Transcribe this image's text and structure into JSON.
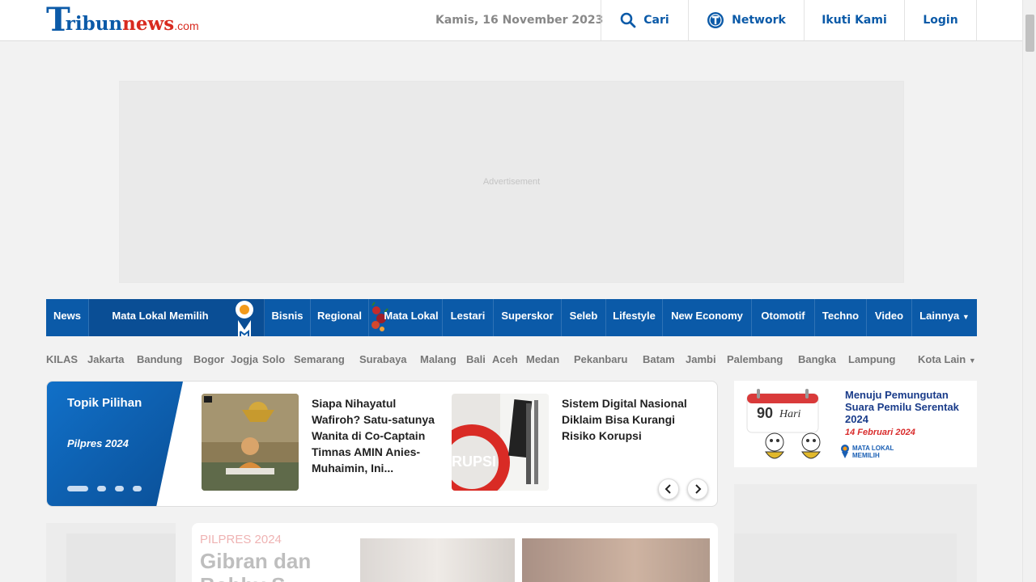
{
  "header": {
    "logo_t": "T",
    "logo_ribun": "ribun",
    "logo_news": "news",
    "logo_com": ".com",
    "date": "Kamis, 16 November 2023",
    "cari": "Cari",
    "network": "Network",
    "ikuti": "Ikuti Kami",
    "login": "Login"
  },
  "ad": {
    "label": "Advertisement"
  },
  "mainnav": {
    "items": [
      "News",
      "Mata Lokal Memilih",
      "Bisnis",
      "Regional",
      "Mata Lokal",
      "Lestari",
      "Superskor",
      "Seleb",
      "Lifestyle",
      "New Economy",
      "Otomotif",
      "Techno",
      "Video",
      "Lainnya"
    ]
  },
  "kilas": {
    "label": "KILAS",
    "cities": [
      "Jakarta",
      "Bandung",
      "Bogor",
      "Jogja",
      "Solo",
      "Semarang",
      "Surabaya",
      "Malang",
      "Bali",
      "Aceh",
      "Medan",
      "Pekanbaru",
      "Batam",
      "Jambi",
      "Palembang",
      "Bangka",
      "Lampung"
    ],
    "more": "Kota Lain"
  },
  "topik": {
    "title": "Topik Pilihan",
    "subtitle": "Pilpres 2024",
    "stories": [
      {
        "title": "Siapa Nihayatul Wafiroh? Satu-satunya Wanita di Co-Captain Timnas AMIN Anies-Muhaimin, Ini..."
      },
      {
        "title": "Sistem Digital Nasional Diklaim Bisa Kurangi Risiko Korupsi"
      }
    ],
    "thumb2_text": "RUPSI"
  },
  "banner": {
    "days": "90",
    "hari": "Hari",
    "line1": "Menuju Pemungutan Suara Pemilu Serentak 2024",
    "date": "14 Februari 2024",
    "brand1": "MATA LOKAL",
    "brand2": "MEMILIH"
  },
  "headline": {
    "kicker": "PILPRES 2024",
    "title": "Gibran dan Bobby S..."
  },
  "colors": {
    "brand_blue": "#0b5aa8",
    "brand_red": "#d82a1f"
  }
}
